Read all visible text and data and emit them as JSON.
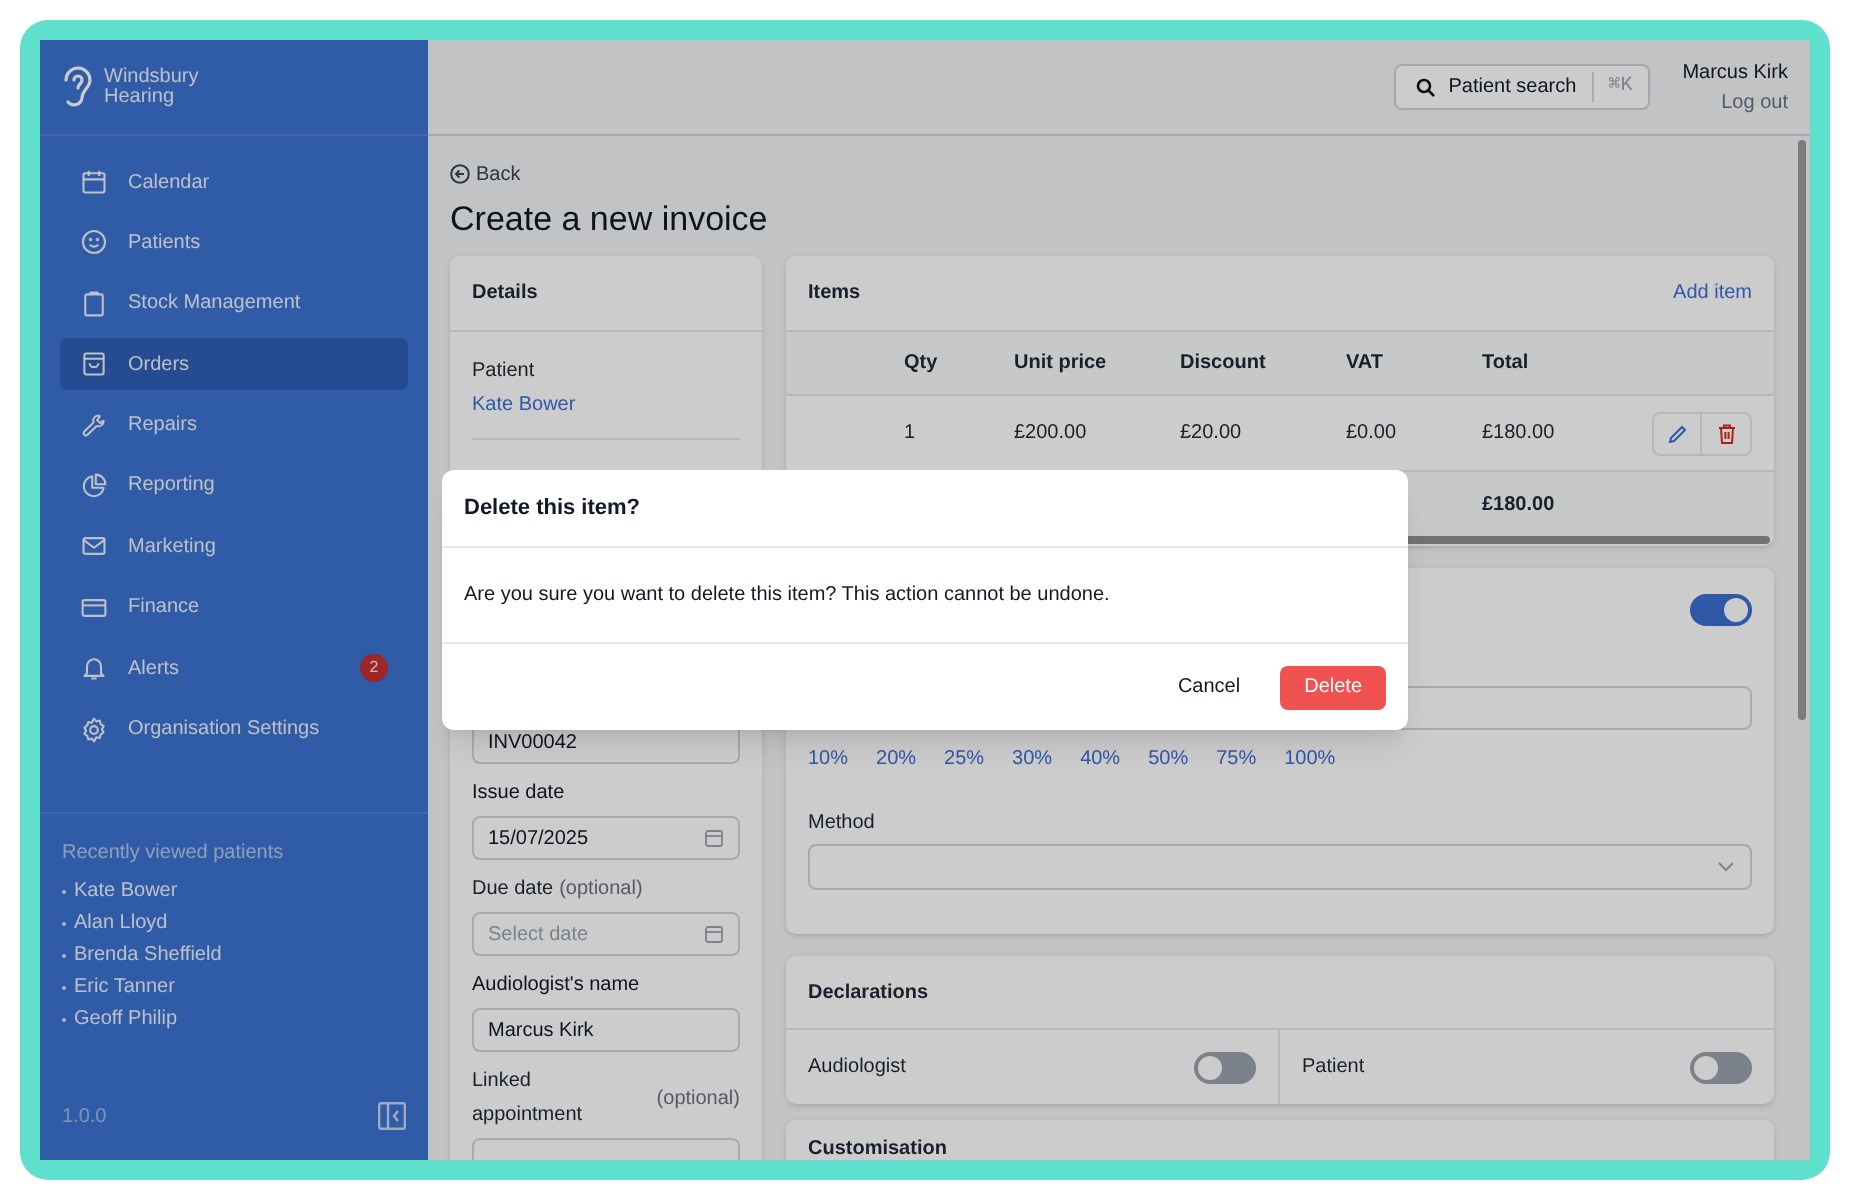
{
  "brand": {
    "line1": "Windsbury",
    "line2": "Hearing"
  },
  "nav": [
    {
      "label": "Calendar",
      "kind": "calendar",
      "selected": false
    },
    {
      "label": "Patients",
      "kind": "smile",
      "selected": false
    },
    {
      "label": "Stock Management",
      "kind": "clipboard",
      "selected": false
    },
    {
      "label": "Orders",
      "kind": "bag",
      "selected": true
    },
    {
      "label": "Repairs",
      "kind": "wrench",
      "selected": false
    },
    {
      "label": "Reporting",
      "kind": "pie",
      "selected": false
    },
    {
      "label": "Marketing",
      "kind": "mail",
      "selected": false
    },
    {
      "label": "Finance",
      "kind": "card",
      "selected": false
    },
    {
      "label": "Alerts",
      "kind": "bell",
      "selected": false,
      "badge": "2"
    },
    {
      "label": "Organisation Settings",
      "kind": "gear",
      "selected": false
    }
  ],
  "recent": {
    "title": "Recently viewed patients",
    "items": [
      "Kate Bower",
      "Alan Lloyd",
      "Brenda Sheffield",
      "Eric Tanner",
      "Geoff Philip"
    ]
  },
  "version": "1.0.0",
  "header": {
    "search": "Patient search",
    "shortcut": "⌘K",
    "user": "Marcus Kirk",
    "logout": "Log out"
  },
  "back": "Back",
  "title": "Create a new invoice",
  "details": {
    "title": "Details",
    "patient_label": "Patient",
    "patient": "Kate Bower",
    "fields": [
      {
        "kind": "text",
        "value": "INV00042"
      },
      {
        "kind": "date",
        "label": "Issue date",
        "value": "15/07/2025"
      },
      {
        "kind": "date",
        "label": "Due date",
        "optional": "(optional)",
        "placeholder": "Select date"
      },
      {
        "kind": "text",
        "label": "Audiologist's name",
        "value": "Marcus Kirk"
      },
      {
        "kind": "text",
        "label": "Linked appointment",
        "optional": "(optional)"
      }
    ]
  },
  "items": {
    "title": "Items",
    "add": "Add item",
    "columns": [
      "Qty",
      "Unit price",
      "Discount",
      "VAT",
      "Total"
    ],
    "rows": [
      [
        "1",
        "£200.00",
        "£20.00",
        "£0.00",
        "£180.00"
      ]
    ],
    "total": "£180.00"
  },
  "payment": {
    "on": true,
    "percentages": [
      "10%",
      "20%",
      "25%",
      "30%",
      "40%",
      "50%",
      "75%",
      "100%"
    ],
    "method_label": "Method"
  },
  "declarations": {
    "title": "Declarations",
    "toggles": [
      {
        "label": "Audiologist",
        "on": false
      },
      {
        "label": "Patient",
        "on": false
      }
    ]
  },
  "next_card": "Customisation",
  "dialog": {
    "title": "Delete this item?",
    "message": "Are you sure you want to delete this item? This action cannot be undone.",
    "cancel": "Cancel",
    "confirm": "Delete"
  }
}
